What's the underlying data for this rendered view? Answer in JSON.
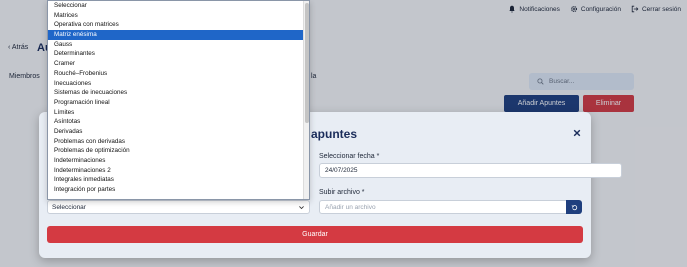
{
  "topnav": {
    "notifications_label": "Notificaciones",
    "settings_label": "Configuración",
    "logout_label": "Cerrar sesión"
  },
  "page": {
    "back_label": "‹ Atrás",
    "title": "Au",
    "members_label": "Miembros",
    "trail_text": "la",
    "search_placeholder": "Buscar...",
    "add_button": "Añadir Apuntes",
    "delete_button": "Eliminar"
  },
  "modal": {
    "title": "apuntes",
    "date_label": "Seleccionar fecha *",
    "date_value": "24/07/2025",
    "file_label": "Subir archivo *",
    "file_placeholder": "Añadir un archivo",
    "select_value": "Seleccionar",
    "save_button": "Guardar"
  },
  "dropdown": {
    "selected_index": 3,
    "options": [
      "Seleccionar",
      "Matrices",
      "Operativa con matrices",
      "Matriz enésima",
      "Gauss",
      "Determinantes",
      "Cramer",
      "Rouché–Frobenius",
      "Inecuaciones",
      "Sistemas de inecuaciones",
      "Programación lineal",
      "Límites",
      "Asíntotas",
      "Derivadas",
      "Problemas con derivadas",
      "Problemas de optimización",
      "Indeterminaciones",
      "Indeterminaciones 2",
      "Integrales inmediatas",
      "Integración por partes"
    ]
  },
  "colors": {
    "primary": "#1f3f7e",
    "danger": "#d43a42",
    "selected_option": "#1f66c8"
  }
}
